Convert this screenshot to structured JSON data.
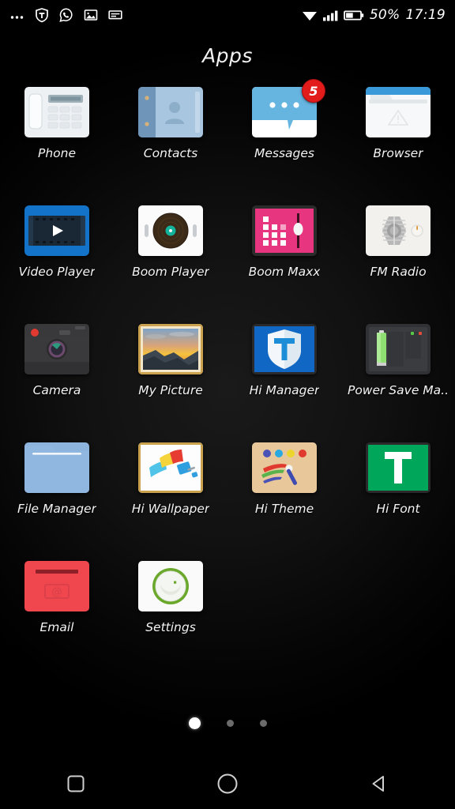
{
  "statusbar": {
    "left_icons": [
      {
        "name": "more-overflow-icon",
        "glyph": "more"
      },
      {
        "name": "shield-icon",
        "glyph": "shield"
      },
      {
        "name": "whatsapp-icon",
        "glyph": "whatsapp"
      },
      {
        "name": "gallery-image-icon",
        "glyph": "image"
      },
      {
        "name": "sms-message-icon",
        "glyph": "message"
      }
    ],
    "wifi_icon": "wifi-icon",
    "signal_icon": "signal-bars-icon",
    "battery_icon": "battery-half-icon",
    "battery_percent": "50%",
    "time": "17:19"
  },
  "header": {
    "title": "Apps"
  },
  "apps": [
    {
      "label": "Phone",
      "icon": "phone-icon",
      "badge": null
    },
    {
      "label": "Contacts",
      "icon": "contacts-icon",
      "badge": null
    },
    {
      "label": "Messages",
      "icon": "messages-icon",
      "badge": "5"
    },
    {
      "label": "Browser",
      "icon": "browser-icon",
      "badge": null
    },
    {
      "label": "Video Player",
      "icon": "video-player-icon",
      "badge": null
    },
    {
      "label": "Boom Player",
      "icon": "boom-player-icon",
      "badge": null
    },
    {
      "label": "Boom Maxx",
      "icon": "boom-maxx-icon",
      "badge": null
    },
    {
      "label": "FM Radio",
      "icon": "fm-radio-icon",
      "badge": null
    },
    {
      "label": "Camera",
      "icon": "camera-icon",
      "badge": null
    },
    {
      "label": "My Picture",
      "icon": "my-picture-icon",
      "badge": null
    },
    {
      "label": "Hi Manager",
      "icon": "hi-manager-icon",
      "badge": null
    },
    {
      "label": "Power Save Ma..",
      "icon": "power-save-icon",
      "badge": null
    },
    {
      "label": "File Manager",
      "icon": "file-manager-icon",
      "badge": null
    },
    {
      "label": "Hi Wallpaper",
      "icon": "hi-wallpaper-icon",
      "badge": null
    },
    {
      "label": "Hi Theme",
      "icon": "hi-theme-icon",
      "badge": null
    },
    {
      "label": "Hi Font",
      "icon": "hi-font-icon",
      "badge": null
    },
    {
      "label": "Email",
      "icon": "email-icon",
      "badge": null
    },
    {
      "label": "Settings",
      "icon": "settings-icon",
      "badge": null
    }
  ],
  "pager": {
    "total_pages": 3,
    "active_page": 1
  },
  "navbar": {
    "recents_label": "recents-square",
    "home_label": "home-circle",
    "back_label": "back-triangle"
  },
  "colors": {
    "background": "#000000",
    "badge_red": "#e21b1b",
    "accent_blue": "#1878c8",
    "boom_maxx_pink": "#e8357f",
    "hi_font_green": "#00a65a",
    "email_red": "#f0474f",
    "settings_green": "#6aa82b"
  }
}
